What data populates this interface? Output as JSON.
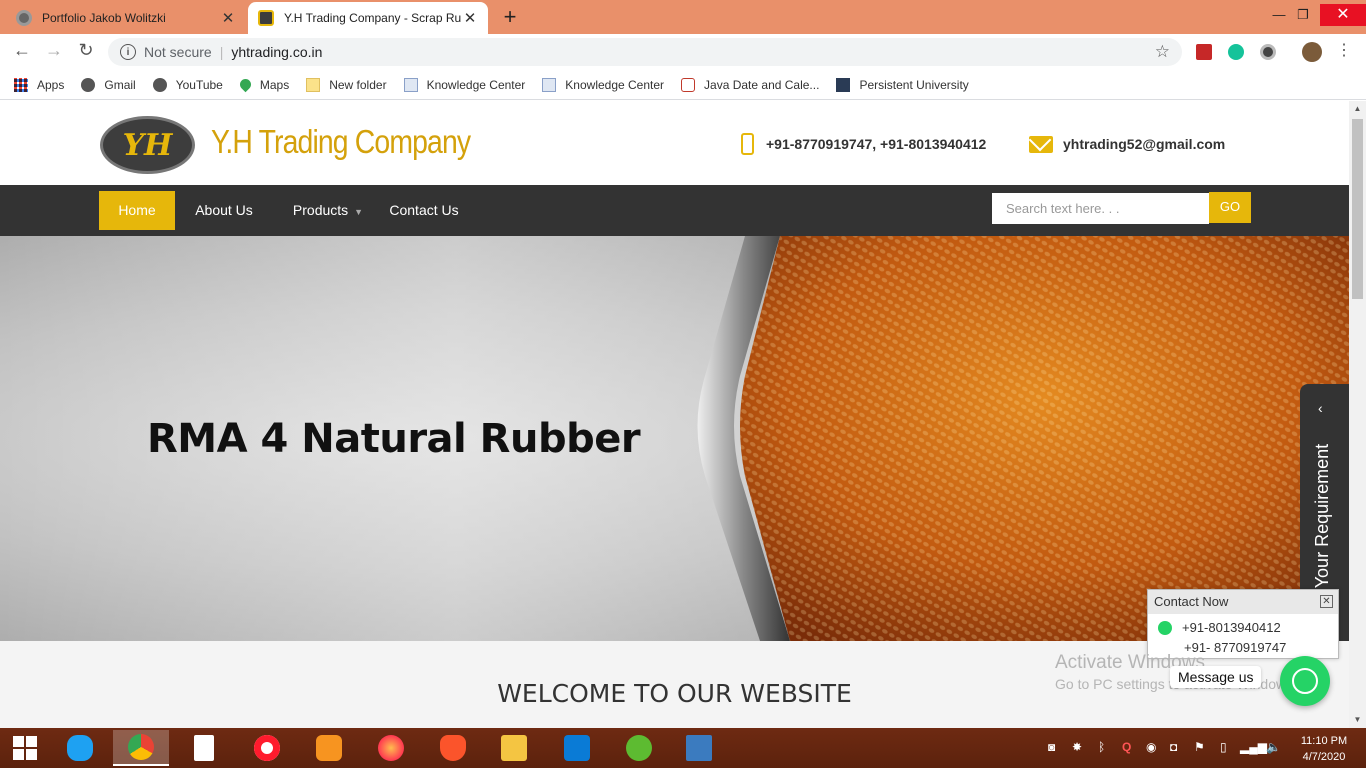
{
  "browser": {
    "tabs": [
      {
        "title": "Portfolio Jakob Wolitzki",
        "active": false
      },
      {
        "title": "Y.H Trading Company - Scrap Ru",
        "active": true
      }
    ],
    "security_label": "Not secure",
    "url": "yhtrading.co.in",
    "bookmarks": [
      {
        "label": "Apps",
        "icon": "apps-grid-icon"
      },
      {
        "label": "Gmail",
        "icon": "globe-icon"
      },
      {
        "label": "YouTube",
        "icon": "globe-icon"
      },
      {
        "label": "Maps",
        "icon": "maps-pin-icon"
      },
      {
        "label": "New folder",
        "icon": "folder-icon"
      },
      {
        "label": "Knowledge Center",
        "icon": "page-icon"
      },
      {
        "label": "Knowledge Center",
        "icon": "page-icon"
      },
      {
        "label": "Java Date and Cale...",
        "icon": "help-page-icon"
      },
      {
        "label": "Persistent University",
        "icon": "building-icon"
      }
    ]
  },
  "site": {
    "logo_text": "YH",
    "company_name": "Y.H Trading Company",
    "phones": "+91-8770919747, +91-8013940412",
    "email": "yhtrading52@gmail.com",
    "nav": {
      "home": "Home",
      "about": "About Us",
      "products": "Products",
      "contact": "Contact Us"
    },
    "search_placeholder": "Search text here. . .",
    "search_button": "GO",
    "hero_title": "RMA 4 Natural Rubber",
    "requirement_tab": "Submit Your Requirement",
    "welcome": "WELCOME TO OUR WEBSITE",
    "contact_now": {
      "title": "Contact Now",
      "phone1": "+91-8013940412",
      "phone2": "+91- 8770919747"
    },
    "message_us": "Message us",
    "watermark_line1": "Activate Windows",
    "watermark_line2": "Go to PC settings to activate Windows.",
    "accent_color": "#e6b70b"
  },
  "taskbar": {
    "apps": [
      "internet-explorer-icon",
      "chrome-icon",
      "file-icon",
      "opera-icon",
      "uc-browser-icon",
      "firefox-icon",
      "brave-icon",
      "file-explorer-icon",
      "vscode-icon",
      "utorrent-icon",
      "photos-icon"
    ],
    "time": "11:10 PM",
    "date": "4/7/2020"
  }
}
